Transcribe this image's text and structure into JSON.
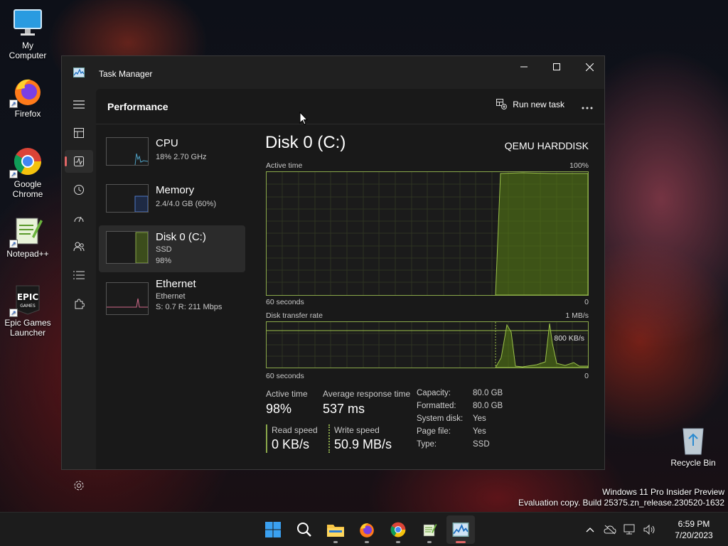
{
  "desktop": {
    "icons": [
      {
        "label": "My Computer",
        "icon": "monitor-icon"
      },
      {
        "label": "Firefox",
        "icon": "firefox-icon"
      },
      {
        "label": "Google Chrome",
        "icon": "chrome-icon"
      },
      {
        "label": "Notepad++",
        "icon": "notepadpp-icon"
      },
      {
        "label": "Epic Games Launcher",
        "icon": "epic-games-icon"
      },
      {
        "label": "Recycle Bin",
        "icon": "recycle-bin-icon"
      }
    ],
    "watermark": {
      "line1": "Windows 11 Pro Insider Preview",
      "line2": "Evaluation copy. Build 25375.zn_release.230520-1632"
    }
  },
  "window": {
    "title": "Task Manager",
    "header": {
      "page_title": "Performance",
      "run_new_task": "Run new task"
    },
    "resources": [
      {
        "name": "CPU",
        "sub1": "18% 2.70 GHz",
        "sub2": "",
        "color": "#4fa3c7"
      },
      {
        "name": "Memory",
        "sub1": "2.4/4.0 GB (60%)",
        "sub2": "",
        "color": "#4f78c7"
      },
      {
        "name": "Disk 0 (C:)",
        "sub1": "SSD",
        "sub2": "98%",
        "color": "#8aa84a"
      },
      {
        "name": "Ethernet",
        "sub1": "Ethernet",
        "sub2": "S: 0.7 R: 211 Mbps",
        "color": "#d06a8a"
      }
    ],
    "detail": {
      "title": "Disk 0 (C:)",
      "model": "QEMU HARDDISK",
      "active_time_graph": {
        "label": "Active time",
        "max_label": "100%",
        "x_left": "60 seconds",
        "x_right": "0"
      },
      "transfer_graph": {
        "label": "Disk transfer rate",
        "max_label": "1 MB/s",
        "ref_label": "800 KB/s",
        "x_left": "60 seconds",
        "x_right": "0"
      },
      "stats": {
        "active_time_label": "Active time",
        "active_time_value": "98%",
        "avg_response_label": "Average response time",
        "avg_response_value": "537 ms",
        "read_label": "Read speed",
        "read_value": "0 KB/s",
        "write_label": "Write speed",
        "write_value": "50.9 MB/s"
      },
      "props": [
        {
          "k": "Capacity:",
          "v": "80.0 GB"
        },
        {
          "k": "Formatted:",
          "v": "80.0 GB"
        },
        {
          "k": "System disk:",
          "v": "Yes"
        },
        {
          "k": "Page file:",
          "v": "Yes"
        },
        {
          "k": "Type:",
          "v": "SSD"
        }
      ]
    }
  },
  "taskbar": {
    "apps": [
      "start-icon",
      "search-icon",
      "file-explorer-icon",
      "firefox-icon",
      "chrome-icon",
      "notepadpp-icon",
      "task-manager-icon"
    ],
    "time": "6:59 PM",
    "date": "7/20/2023"
  },
  "colors": {
    "disk": "#8aa84a",
    "accent": "#e06666"
  }
}
